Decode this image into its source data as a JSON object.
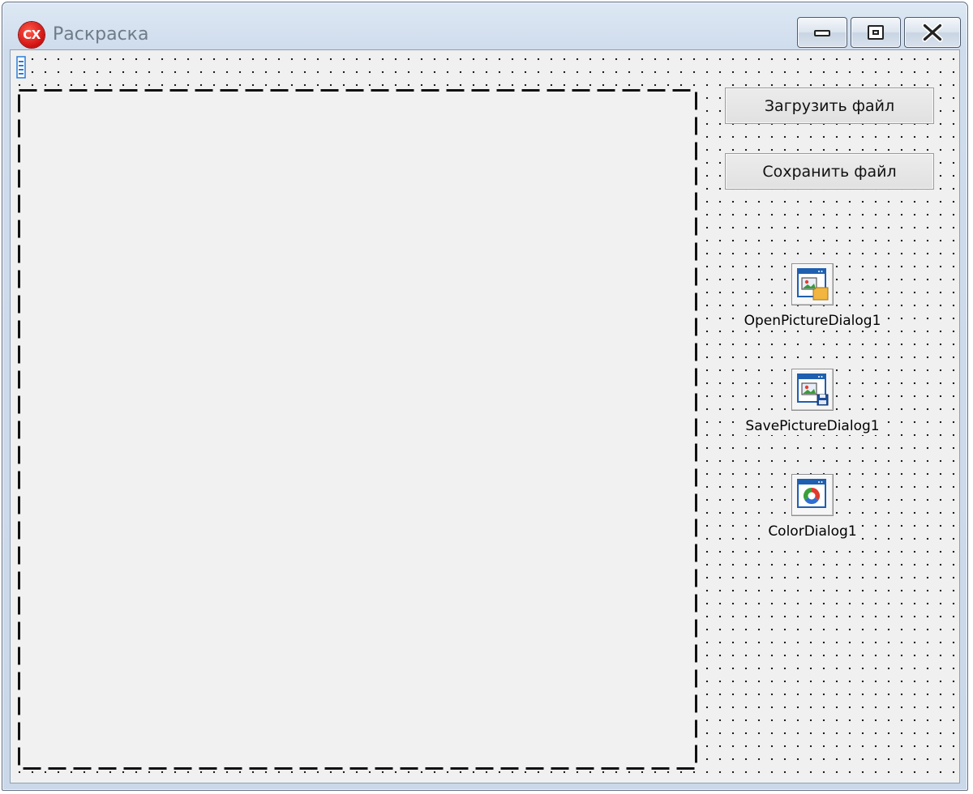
{
  "window": {
    "title": "Раскраска",
    "app_icon_text": "CX",
    "caption_buttons": [
      "minimize-icon",
      "maximize-icon",
      "close-icon"
    ]
  },
  "form": {
    "paintbox": {
      "border_style": "dashed"
    },
    "buttons": {
      "load_label": "Загрузить файл",
      "save_label": "Сохранить файл"
    },
    "components": [
      {
        "label": "OpenPictureDialog1",
        "icon": "open-picture-dialog-icon"
      },
      {
        "label": "SavePictureDialog1",
        "icon": "save-picture-dialog-icon"
      },
      {
        "label": "ColorDialog1",
        "icon": "color-dialog-icon"
      }
    ]
  },
  "colors": {
    "title_text": "#6e7b88",
    "app_icon": "#d01010",
    "form_background": "#f0f0f0",
    "grid_dot": "#1c1c1c"
  }
}
